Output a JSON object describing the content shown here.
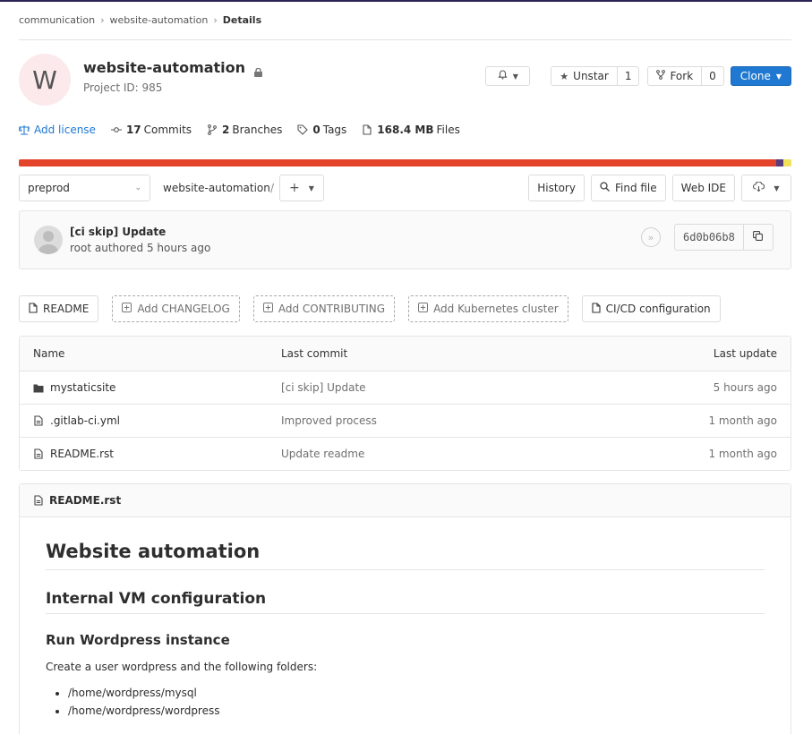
{
  "breadcrumb": [
    "communication",
    "website-automation",
    "Details"
  ],
  "project": {
    "avatar_letter": "W",
    "name": "website-automation",
    "id_text": "Project ID: 985",
    "avatar_bg": "#fbe9eb"
  },
  "actions": {
    "notification_icon": "bell-icon",
    "unstar_label": "Unstar",
    "star_count": "1",
    "fork_label": "Fork",
    "fork_count": "0",
    "clone_label": "Clone"
  },
  "stats": {
    "license": "Add license",
    "commits_num": "17",
    "commits_label": "Commits",
    "branches_num": "2",
    "branches_label": "Branches",
    "tags_num": "0",
    "tags_label": "Tags",
    "files_num": "168.4 MB",
    "files_label": "Files"
  },
  "language_bar": [
    {
      "color": "#e24329",
      "pct": 98.0
    },
    {
      "color": "#563d7c",
      "pct": 1.0
    },
    {
      "color": "#f1e05a",
      "pct": 1.0
    }
  ],
  "toolbar": {
    "branch": "preprod",
    "path": "website-automation",
    "path_sep": "/",
    "add_label": "+",
    "history": "History",
    "find_file": "Find file",
    "web_ide": "Web IDE"
  },
  "commit": {
    "message": "[ci skip] Update",
    "author_line": "root authored 5 hours ago",
    "sha": "6d0b06b8"
  },
  "quick_buttons": {
    "readme": "README",
    "changelog": "Add CHANGELOG",
    "contributing": "Add CONTRIBUTING",
    "kubernetes": "Add Kubernetes cluster",
    "cicd": "CI/CD configuration"
  },
  "tree": {
    "headers": {
      "name": "Name",
      "last_commit": "Last commit",
      "last_update": "Last update"
    },
    "rows": [
      {
        "name": "mystaticsite",
        "commit": "[ci skip] Update",
        "updated": "5 hours ago",
        "type": "folder"
      },
      {
        "name": ".gitlab-ci.yml",
        "commit": "Improved process",
        "updated": "1 month ago",
        "type": "file"
      },
      {
        "name": "README.rst",
        "commit": "Update readme",
        "updated": "1 month ago",
        "type": "file"
      }
    ]
  },
  "readme": {
    "filename": "README.rst",
    "h1": "Website automation",
    "h2": "Internal VM configuration",
    "h3": "Run Wordpress instance",
    "paragraph": "Create a user wordpress and the following folders:",
    "list": [
      "/home/wordpress/mysql",
      "/home/wordpress/wordpress"
    ]
  }
}
